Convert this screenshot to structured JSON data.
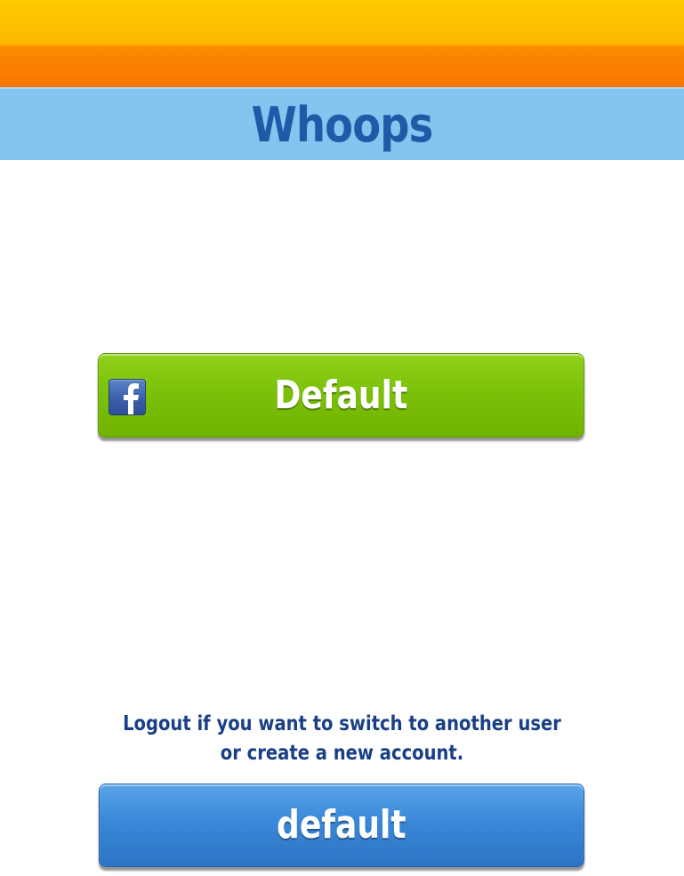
{
  "header": {
    "title": "Whoops"
  },
  "facebook_button": {
    "label": "Default",
    "icon": "facebook-icon",
    "color": "#7cc10a"
  },
  "message": {
    "line1": "Logout if you want to switch to another user",
    "line2": "or create a new account."
  },
  "logout_button": {
    "label": "default",
    "color": "#3a88d8"
  },
  "colors": {
    "top_bar": "#fb9a00",
    "title_bar": "#85c4ee",
    "title_text": "#1e5aa8",
    "message_text": "#1a3f86"
  }
}
